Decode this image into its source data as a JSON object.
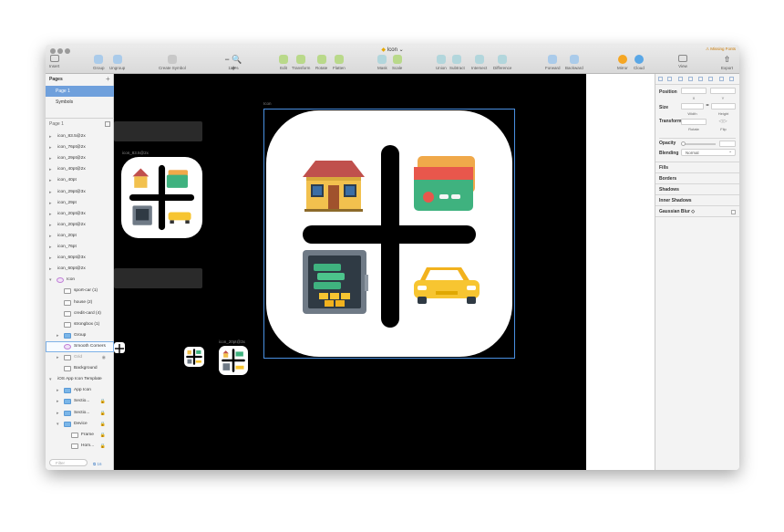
{
  "window": {
    "title": "Icon",
    "title_suffix": "⌄",
    "missing_fonts": "⚠ Missing Fonts"
  },
  "toolbar": {
    "insert": "Insert",
    "group": "Group",
    "ungroup": "Ungroup",
    "create_symbol": "Create Symbol",
    "zoom": "110%",
    "zoom_glyph": "− 🔍 +",
    "edit": "Edit",
    "transform": "Transform",
    "rotate": "Rotate",
    "flatten": "Flatten",
    "mask": "Mask",
    "scale": "Scale",
    "union": "Union",
    "subtract": "Subtract",
    "intersect": "Intersect",
    "difference": "Difference",
    "forward": "Forward",
    "backward": "Backward",
    "mirror": "Mirror",
    "cloud": "Cloud",
    "view": "View",
    "export": "Export"
  },
  "pages": {
    "header": "Pages",
    "add": "+",
    "items": [
      {
        "label": "Page 1"
      },
      {
        "label": "Symbols"
      }
    ]
  },
  "layers": {
    "header": "Page 1",
    "items": [
      {
        "label": "icon_83.5@2x"
      },
      {
        "label": "icon_76pt@2x"
      },
      {
        "label": "icon_29pt@2x"
      },
      {
        "label": "icon_40pt@2x"
      },
      {
        "label": "icon_40pt"
      },
      {
        "label": "icon_29pt@3x"
      },
      {
        "label": "icon_29pt"
      },
      {
        "label": "icon_20pt@3x"
      },
      {
        "label": "icon_20pt@2x"
      },
      {
        "label": "icon_20pt"
      },
      {
        "label": "icon_76pt"
      },
      {
        "label": "icon_60pt@3x"
      },
      {
        "label": "icon_60pt@2x"
      },
      {
        "label": "Icon"
      },
      {
        "label": "sport-car (1)"
      },
      {
        "label": "house (2)"
      },
      {
        "label": "credit-card (4)"
      },
      {
        "label": "strongbox (1)"
      },
      {
        "label": "Group"
      },
      {
        "label": "Smooth Corners"
      },
      {
        "label": "Grid"
      },
      {
        "label": "Background"
      },
      {
        "label": "iOS App Icon Template"
      },
      {
        "label": "App Icon"
      },
      {
        "label": "Sectio..."
      },
      {
        "label": "Sectio..."
      },
      {
        "label": "Device"
      },
      {
        "label": "Frame"
      },
      {
        "label": "Hom..."
      }
    ],
    "filter_placeholder": "Filter",
    "filter_count": "16"
  },
  "canvas": {
    "label_small": "icon_83.5@2x",
    "label_tiny": "icon_20pt@3x",
    "label_main": "Icon"
  },
  "inspector": {
    "position": "Position",
    "x": "X",
    "y": "Y",
    "size": "Size",
    "width": "Width",
    "height": "Height",
    "transform": "Transform",
    "rotate": "Rotate",
    "flip": "Flip",
    "opacity": "Opacity",
    "blending": "Blending",
    "blending_value": "Normal",
    "fills": "Fills",
    "borders": "Borders",
    "shadows": "Shadows",
    "inner_shadows": "Inner Shadows",
    "gaussian_blur": "Gaussian Blur ◇"
  },
  "colors": {
    "selection": "#6fa0dc",
    "artboard_outline": "#4a90e2",
    "house_roof": "#c0504d",
    "house_wall": "#f2c14e",
    "card_back": "#f0a94a",
    "card_front": "#3fb27f",
    "car_body": "#f7c531"
  }
}
